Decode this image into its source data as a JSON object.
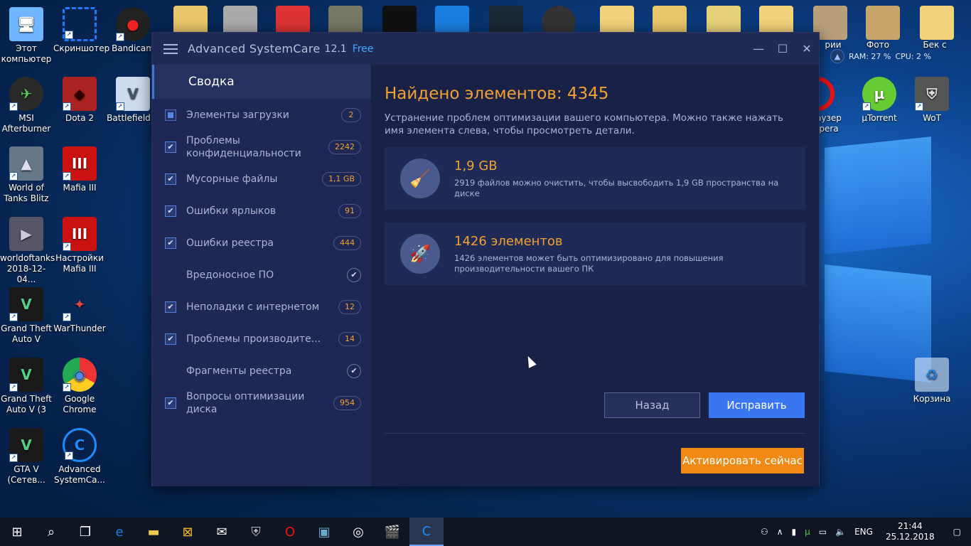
{
  "desktop": {
    "icons": [
      {
        "label": "Этот компьютер",
        "color": "#6fb5ff",
        "glyph": "🖥"
      },
      {
        "label": "Скриншотер",
        "color": "#1e7bff",
        "glyph": "⛶"
      },
      {
        "label": "Bandicam",
        "color": "#d22",
        "glyph": "●"
      },
      {
        "label": "MSI Afterburner",
        "color": "#5a7",
        "glyph": "✈"
      },
      {
        "label": "Dota 2",
        "color": "#a22",
        "glyph": "◆"
      },
      {
        "label": "Battlefield V",
        "color": "#b8c8e0",
        "glyph": "V"
      },
      {
        "label": "World of Tanks Blitz",
        "color": "#678",
        "glyph": "▲"
      },
      {
        "label": "Mafia III",
        "color": "#c11",
        "glyph": "III"
      },
      {
        "label": "worldoftanks 2018-12-04...",
        "color": "#556",
        "glyph": "▶"
      },
      {
        "label": "Настройки Mafia III",
        "color": "#c11",
        "glyph": "III"
      },
      {
        "label": "Grand Theft Auto V",
        "color": "#3a6",
        "glyph": "V"
      },
      {
        "label": "WarThunder",
        "color": "#a33",
        "glyph": "✦"
      },
      {
        "label": "Grand Theft Auto V (3",
        "color": "#3a6",
        "glyph": "V"
      },
      {
        "label": "Google Chrome",
        "color": "#e44",
        "glyph": "◉"
      },
      {
        "label": "GTA V (Сетев...",
        "color": "#3a6",
        "glyph": "V"
      },
      {
        "label": "Advanced SystemCa...",
        "color": "#1a8cff",
        "glyph": "C"
      }
    ],
    "right_icons": [
      {
        "label": "µTorrent",
        "color": "#6c3",
        "glyph": "µ"
      },
      {
        "label": "WoT",
        "color": "#888",
        "glyph": "⛨"
      },
      {
        "label": "Корзина",
        "color": "#9cd",
        "glyph": "♻"
      }
    ],
    "partial_labels": [
      "аузер",
      "pera",
      "Фото",
      "Бек с",
      "рии"
    ],
    "widget": {
      "ram": "RAM: 27 %",
      "cpu": "CPU: 2 %"
    }
  },
  "window": {
    "title": "Advanced SystemCare",
    "version": "12.1",
    "edition": "Free"
  },
  "sidebar": {
    "header": "Сводка",
    "items": [
      {
        "label": "Элементы загрузки",
        "state": "partial",
        "count": "2"
      },
      {
        "label": "Проблемы конфиденциальности",
        "state": "checked",
        "count": "2242"
      },
      {
        "label": "Мусорные файлы",
        "state": "checked",
        "count": "1,1 GB"
      },
      {
        "label": "Ошибки ярлыков",
        "state": "checked",
        "count": "91"
      },
      {
        "label": "Ошибки реестра",
        "state": "checked",
        "count": "444"
      },
      {
        "label": "Вредоносное ПО",
        "state": "none",
        "count": ""
      },
      {
        "label": "Неполадки с интернетом",
        "state": "checked",
        "count": "12"
      },
      {
        "label": "Проблемы производите...",
        "state": "checked",
        "count": "14"
      },
      {
        "label": "Фрагменты реестра",
        "state": "none",
        "count": ""
      },
      {
        "label": "Вопросы оптимизации диска",
        "state": "checked",
        "count": "954"
      }
    ]
  },
  "main": {
    "title": "Найдено элементов: 4345",
    "description": "Устранение проблем оптимизации вашего компьютера. Можно также нажать имя элемента слева, чтобы просмотреть детали.",
    "cards": [
      {
        "value": "1,9 GB",
        "text": "2919 файлов можно очистить, чтобы высвободить 1,9 GB пространства на диске"
      },
      {
        "value": "1426 элементов",
        "text": "1426 элементов может быть оптимизировано для повышения производительности вашего ПК"
      }
    ],
    "back_label": "Назад",
    "fix_label": "Исправить",
    "activate_label": "Активировать сейчас"
  },
  "taskbar": {
    "lang": "ENG",
    "time": "21:44",
    "date": "25.12.2018"
  }
}
